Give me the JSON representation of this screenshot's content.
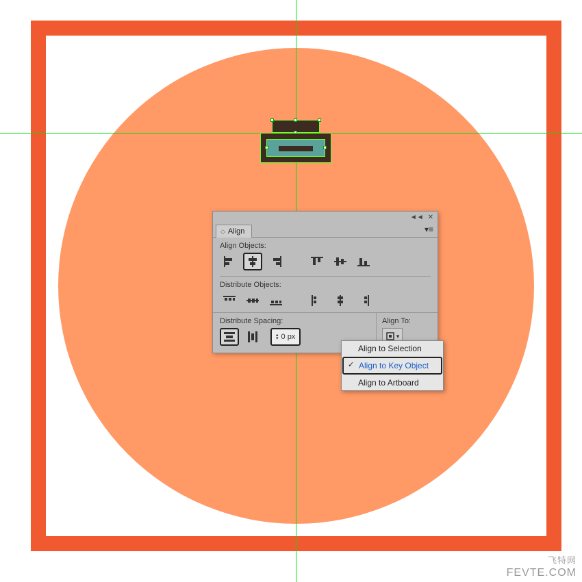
{
  "panel": {
    "tab_label": "Align",
    "sections": {
      "align_objects": "Align Objects:",
      "distribute_objects": "Distribute Objects:",
      "distribute_spacing": "Distribute Spacing:",
      "align_to": "Align To:"
    },
    "spacing_value": "0 px",
    "dropdown": {
      "items": [
        "Align to Selection",
        "Align to Key Object",
        "Align to Artboard"
      ],
      "selected_index": 1
    }
  },
  "colors": {
    "frame": "#f15a30",
    "circle": "#ff9966",
    "guide": "#00e010",
    "select_border": "#6cff2a"
  },
  "watermark": {
    "line1": "飞特网",
    "line2": "FEVTE.COM"
  }
}
